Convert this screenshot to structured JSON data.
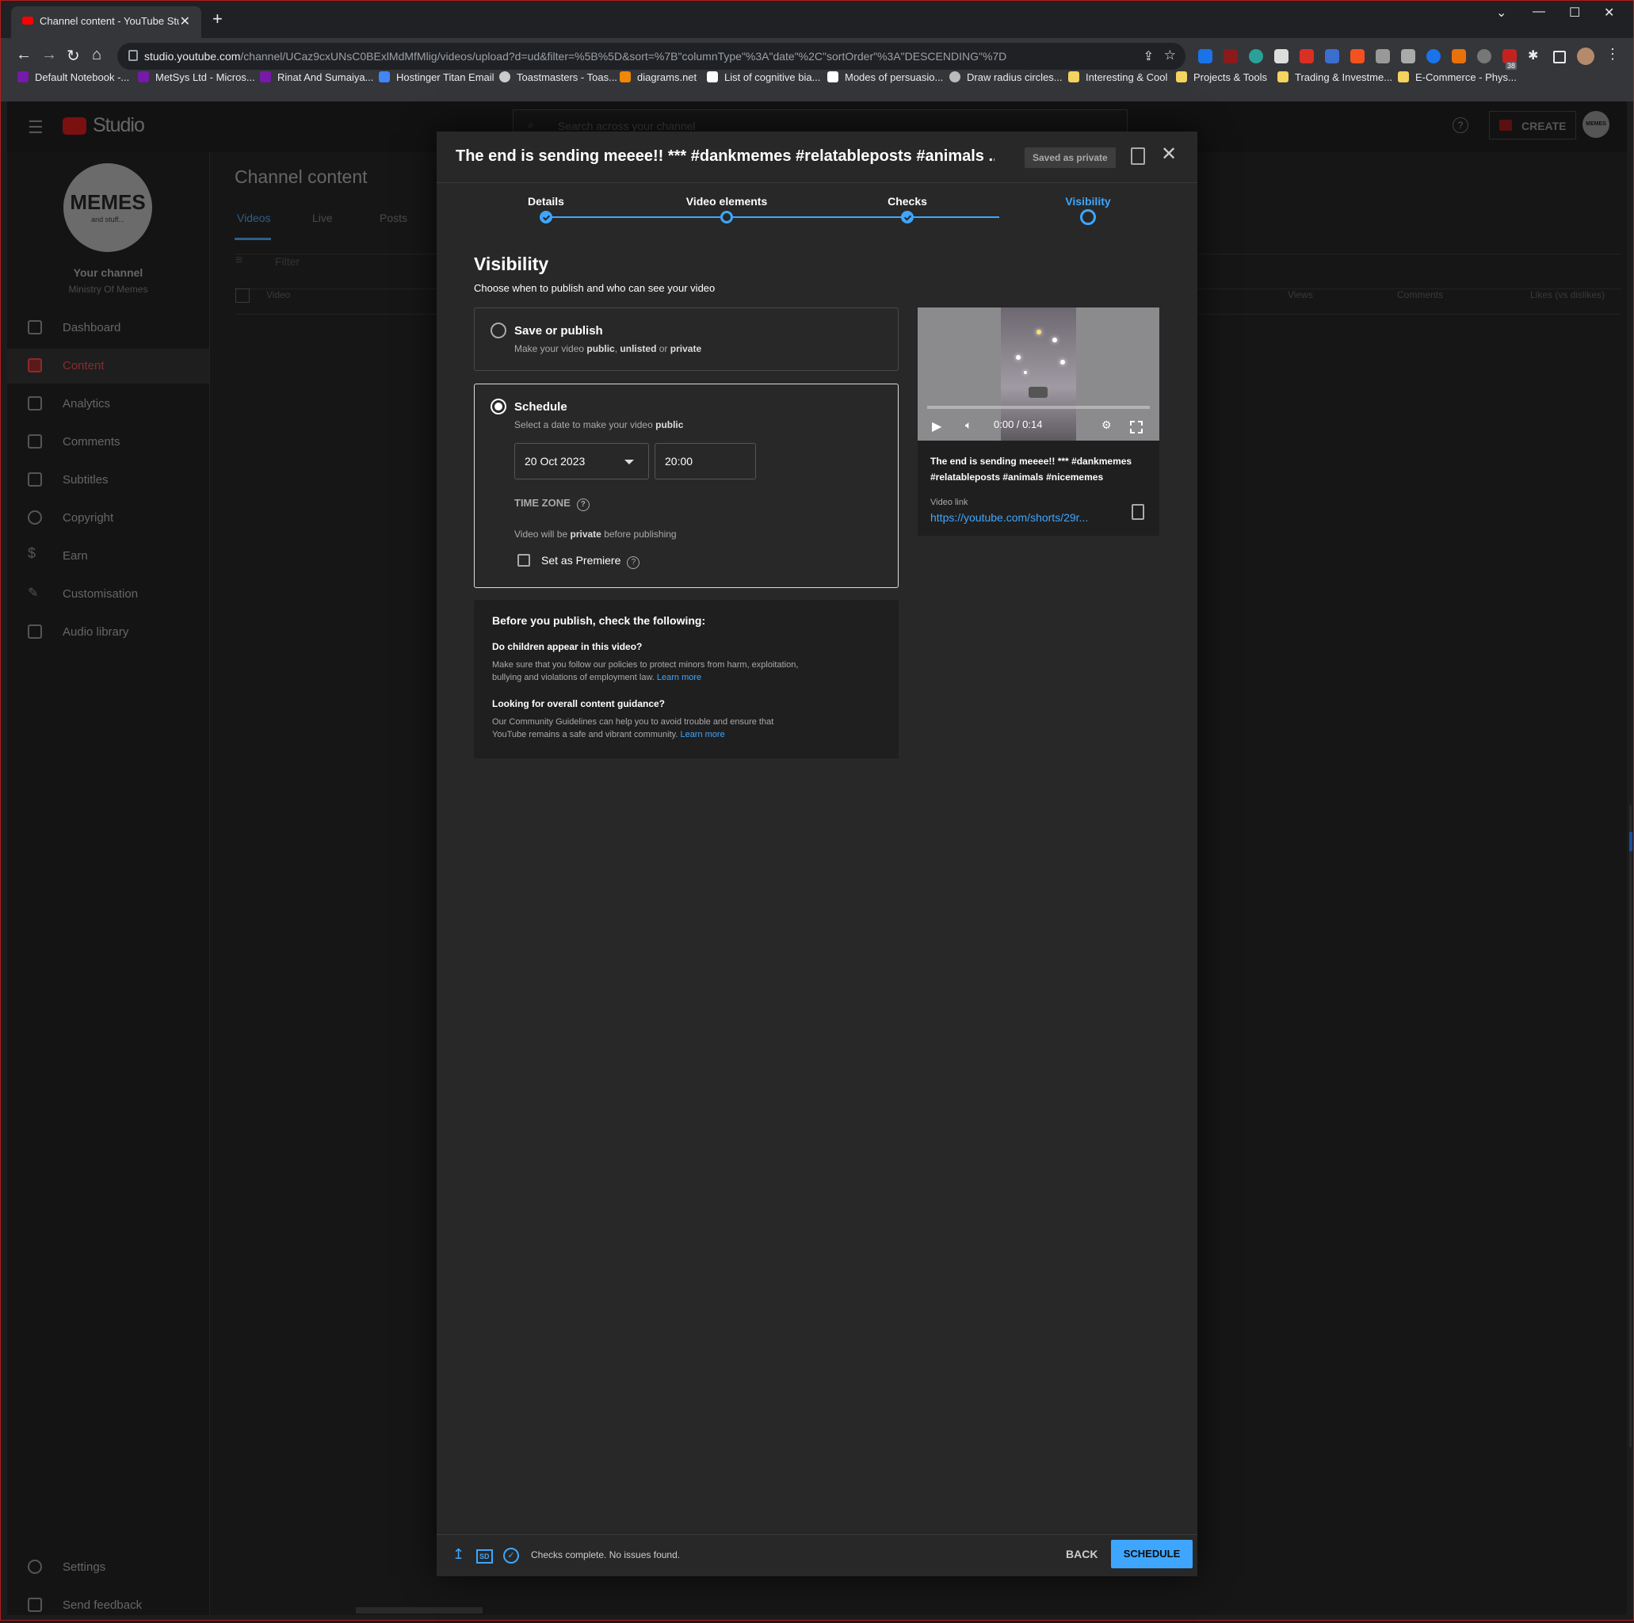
{
  "browser": {
    "tab_title": "Channel content - YouTube Stud",
    "tab_close": "✕",
    "new_tab": "+",
    "url_host": "studio.youtube.com",
    "url_path": "/channel/UCaz9cxUNsC0BExlMdMfMlig/videos/upload?d=ud&filter=%5B%5D&sort=%7B\"columnType\"%3A\"date\"%2C\"sortOrder\"%3A\"DESCENDING\"%7D",
    "extension_badge": "38",
    "bookmarks": [
      "Default Notebook -...",
      "MetSys Ltd - Micros...",
      "Rinat And Sumaiya...",
      "Hostinger Titan Email",
      "Toastmasters - Toas...",
      "diagrams.net",
      "List of cognitive bia...",
      "Modes of persuasio...",
      "Draw radius circles...",
      "Interesting & Cool",
      "Projects & Tools",
      "Trading & Investme...",
      "E-Commerce - Phys..."
    ]
  },
  "studio": {
    "logo_text": "Studio",
    "search_placeholder": "Search across your channel",
    "help_glyph": "?",
    "create_label": "CREATE",
    "avatar_text": "MEMES",
    "page_title": "Channel content",
    "tabs": [
      "Videos",
      "Live",
      "Posts"
    ],
    "filter_label": "Filter",
    "table_headers": [
      "Video",
      "Views",
      "Comments",
      "Likes (vs dislikes)"
    ],
    "channel": {
      "avatar_main": "MEMES",
      "avatar_sub": "and stuff...",
      "label": "Your channel",
      "name": "Ministry Of Memes"
    },
    "nav": [
      "Dashboard",
      "Content",
      "Analytics",
      "Comments",
      "Subtitles",
      "Copyright",
      "Earn",
      "Customisation",
      "Audio library"
    ],
    "nav_bottom": [
      "Settings",
      "Send feedback"
    ]
  },
  "modal": {
    "title": "The end is sending meeee!! *** #dankmemes  #relatableposts #animals  ...",
    "saved_badge": "Saved as private",
    "steps": [
      "Details",
      "Video elements",
      "Checks",
      "Visibility"
    ],
    "heading": "Visibility",
    "subheading": "Choose when to publish and who can see your video",
    "save_option": {
      "title": "Save or publish",
      "desc_pre": "Make your video ",
      "public": "public",
      "sep1": ", ",
      "unlisted": "unlisted",
      "or": " or ",
      "private": "private"
    },
    "schedule_option": {
      "title": "Schedule",
      "desc_pre": "Select a date to make your video ",
      "public": "public",
      "date": "20 Oct 2023",
      "time": "20:00",
      "timezone_label": "TIME ZONE",
      "note_pre": "Video will be ",
      "note_private": "private",
      "note_post": " before publishing",
      "premiere_label": "Set as Premiere"
    },
    "guide": {
      "heading": "Before you publish, check the following:",
      "q1": "Do children appear in this video?",
      "p1": "Make sure that you follow our policies to protect minors from harm, exploitation, bullying and violations of employment law.",
      "q2": "Looking for overall content guidance?",
      "p2": "Our Community Guidelines can help you to avoid trouble and ensure that YouTube remains a safe and vibrant community.",
      "learn_more": "Learn more"
    },
    "preview": {
      "time": "0:00 / 0:14",
      "title": "The end is sending meeee!! *** #dankmemes #relatableposts #animals  #nicememes",
      "link_label": "Video link",
      "link": "https://youtube.com/shorts/29r..."
    },
    "footer": {
      "hd_badge": "SD",
      "status": "Checks complete. No issues found.",
      "back": "BACK",
      "schedule": "SCHEDULE"
    }
  },
  "colors": {
    "accent": "#3ea6ff",
    "brand_red": "#ff0000",
    "modal_bg": "#282828"
  }
}
